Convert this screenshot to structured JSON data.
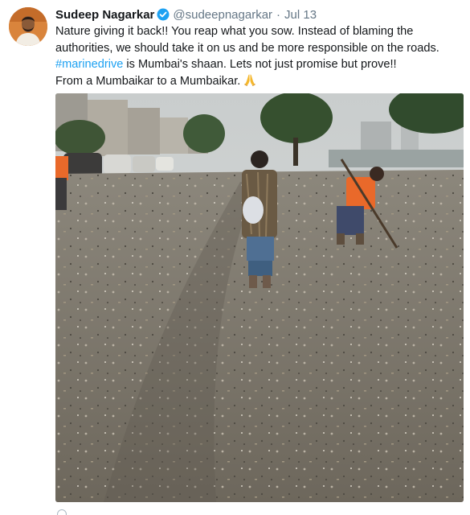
{
  "tweet": {
    "author_name": "Sudeep Nagarkar",
    "handle": "@sudeepnagarkar",
    "separator": "·",
    "time": "Jul 13",
    "text_part1": "Nature giving it back!! You reap what you sow. Instead of blaming the authorities, we should take it on us and be more responsible on the roads.",
    "hashtag": "#marinedrive",
    "text_part2": "is Mumbai's shaan. Lets not just promise but prove!!",
    "text_line2": "From a Mumbaikar to a Mumbaikar.",
    "emoji": "folded-hands-emoji",
    "verified_icon": "verified-badge-icon"
  },
  "colors": {
    "link": "#1da1f2",
    "text": "#14171a",
    "secondary": "#657786"
  }
}
